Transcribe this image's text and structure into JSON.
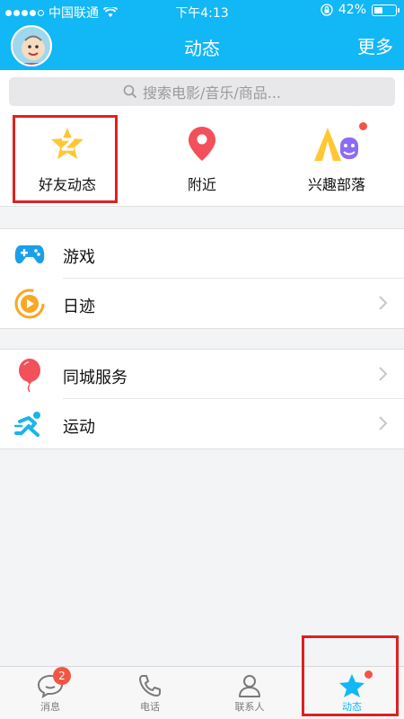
{
  "status_bar": {
    "carrier": "中国联通",
    "time": "下午4:13",
    "battery_percent": "42%",
    "battery_level": 0.42
  },
  "nav": {
    "title": "动态",
    "more": "更多"
  },
  "search": {
    "placeholder": "搜索电影/音乐/商品..."
  },
  "quick_actions": [
    {
      "label": "好友动态",
      "icon": "star-z-icon",
      "dot": false
    },
    {
      "label": "附近",
      "icon": "location-pin-icon",
      "dot": false
    },
    {
      "label": "兴趣部落",
      "icon": "tribe-icon",
      "dot": true
    }
  ],
  "section1": [
    {
      "label": "游戏",
      "icon": "gamepad-icon",
      "chevron": false
    },
    {
      "label": "日迹",
      "icon": "play-circle-icon",
      "chevron": true
    }
  ],
  "section2": [
    {
      "label": "同城服务",
      "icon": "balloon-icon",
      "chevron": true
    },
    {
      "label": "运动",
      "icon": "runner-icon",
      "chevron": true
    }
  ],
  "tabbar": {
    "tabs": [
      {
        "label": "消息",
        "icon": "chat-bubble-icon",
        "badge": "2",
        "active": false
      },
      {
        "label": "电话",
        "icon": "phone-icon",
        "active": false
      },
      {
        "label": "联系人",
        "icon": "person-icon",
        "active": false
      },
      {
        "label": "动态",
        "icon": "star-icon",
        "dot": true,
        "active": true
      }
    ]
  },
  "colors": {
    "accent": "#12b7f5",
    "highlight_box": "#e02020",
    "badge": "#f25643"
  }
}
